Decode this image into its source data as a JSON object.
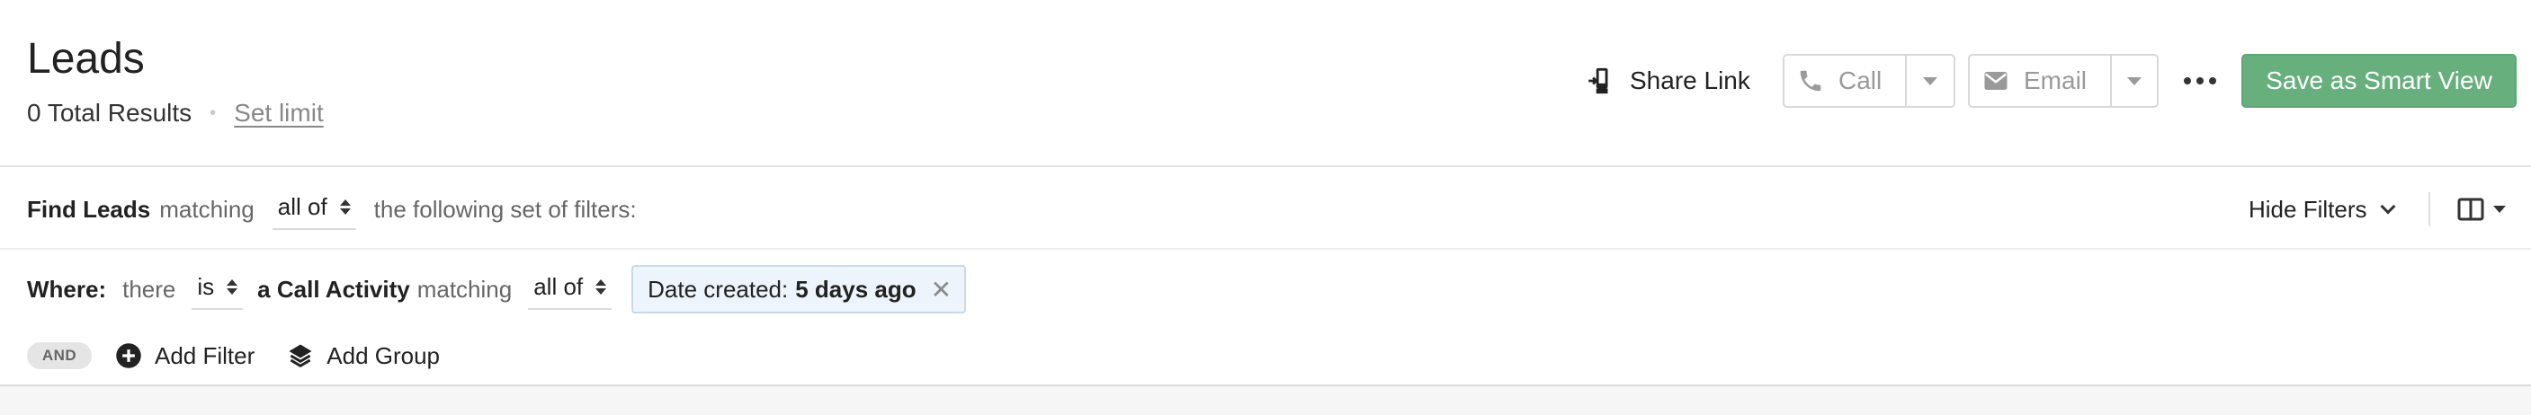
{
  "header": {
    "title": "Leads",
    "total_results": "0 Total Results",
    "set_limit": "Set limit",
    "share_link": "Share Link",
    "call_label": "Call",
    "email_label": "Email",
    "save_smart_view": "Save as Smart View"
  },
  "find_row": {
    "find_label": "Find Leads",
    "matching": "matching",
    "match_mode": "all of",
    "suffix": "the following set of filters:",
    "hide_filters": "Hide Filters"
  },
  "where_row": {
    "where_label": "Where:",
    "there": "there",
    "is_value": "is",
    "activity": "a Call Activity",
    "matching": "matching",
    "match_mode": "all of",
    "chip_label": "Date created:",
    "chip_value": "5 days ago",
    "chip_remove": "✕"
  },
  "logic_row": {
    "and_pill": "AND",
    "add_filter": "Add Filter",
    "add_group": "Add Group"
  },
  "icons": {
    "share": "share-link-icon",
    "call": "phone-icon",
    "email": "envelope-icon",
    "more": "more-horizontal-icon",
    "columns": "columns-icon",
    "add_filter": "plus-circle-icon",
    "add_group": "layers-icon"
  },
  "colors": {
    "primary_green": "#67b07e",
    "chip_bg": "#eef4fb",
    "muted_text": "#666666"
  }
}
